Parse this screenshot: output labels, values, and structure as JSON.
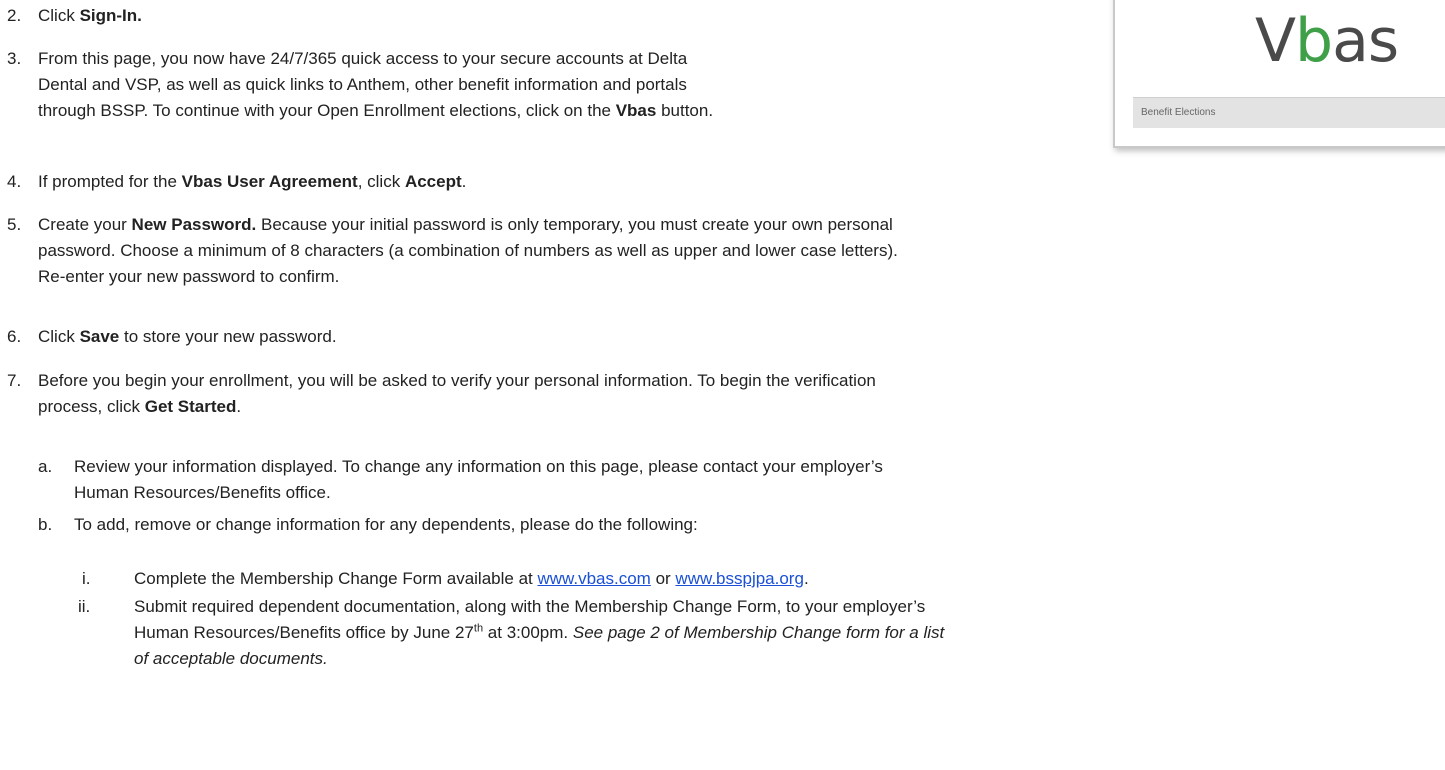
{
  "logo": {
    "text_v": "V",
    "text_b": "b",
    "text_rest": "as",
    "button_label": "Benefit Elections"
  },
  "steps": {
    "s2": {
      "num": "2.",
      "text1": "Click ",
      "bold1": "Sign-In."
    },
    "s3": {
      "num": "3.",
      "line1": "From this page, you now have 24/7/365 quick access to your secure accounts at Delta",
      "line2": "Dental and VSP, as well as quick links to Anthem, other benefit information and portals",
      "line3a": "through BSSP.  To continue with your Open Enrollment elections, click on the ",
      "line3b": "Vbas",
      "line3c": " button."
    },
    "s4": {
      "num": "4.",
      "a": "If prompted for the ",
      "b": "Vbas User Agreement",
      "c": ", click ",
      "d": "Accept",
      "e": "."
    },
    "s5": {
      "num": "5.",
      "a": "Create your ",
      "b": "New Password.",
      "c": " Because your initial password is only temporary, you must create your own personal",
      "line2": "password. Choose a minimum of 8 characters (a combination of numbers as well as upper and lower case letters).",
      "line3": "Re-enter your new password to confirm."
    },
    "s6": {
      "num": "6.",
      "a": "Click ",
      "b": "Save",
      "c": " to store your new password."
    },
    "s7": {
      "num": "7.",
      "line1": "Before you begin your enrollment, you will be asked to verify your personal information. To begin the verification",
      "line2a": "process, click ",
      "line2b": "Get Started",
      "line2c": "."
    },
    "sa": {
      "num": "a.",
      "line1": "Review your information displayed. To change any information on this page, please contact your employer’s",
      "line2": "Human Resources/Benefits office."
    },
    "sb": {
      "num": "b.",
      "line1": "To add, remove or change information for any dependents, please do the following:"
    },
    "si": {
      "num": "i.",
      "a": "Complete the Membership Change Form available at ",
      "link1": "www.vbas.com",
      "or": " or ",
      "link2": "www.bsspjpa.org",
      "end": "."
    },
    "sii": {
      "num": "ii.",
      "line1": "Submit required dependent documentation, along with the Membership Change Form, to your employer’s",
      "line2a": "Human Resources/Benefits office by June  27",
      "sup": "th",
      "line2b": " at 3:00pm. ",
      "line2c": "See page 2 of Membership Change form for a list",
      "line3": "of acceptable documents."
    }
  }
}
